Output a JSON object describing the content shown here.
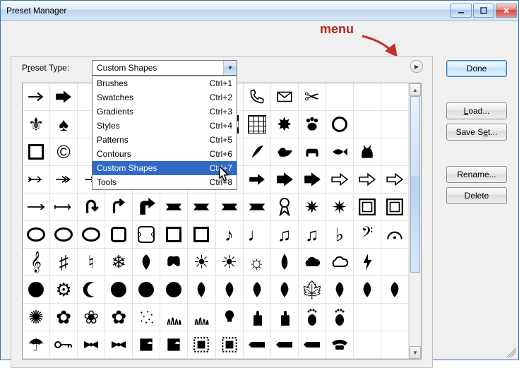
{
  "window": {
    "title": "Preset Manager"
  },
  "annotation": {
    "menu_label": "menu"
  },
  "preset": {
    "label_pre": "P",
    "label_u": "r",
    "label_post": "eset Type:",
    "value": "Custom Shapes"
  },
  "dropdown": {
    "items": [
      {
        "label": "Brushes",
        "shortcut": "Ctrl+1"
      },
      {
        "label": "Swatches",
        "shortcut": "Ctrl+2"
      },
      {
        "label": "Gradients",
        "shortcut": "Ctrl+3"
      },
      {
        "label": "Styles",
        "shortcut": "Ctrl+4"
      },
      {
        "label": "Patterns",
        "shortcut": "Ctrl+5"
      },
      {
        "label": "Contours",
        "shortcut": "Ctrl+6"
      },
      {
        "label": "Custom Shapes",
        "shortcut": "Ctrl+7",
        "selected": true
      },
      {
        "label": "Tools",
        "shortcut": "Ctrl+8"
      }
    ]
  },
  "buttons": {
    "done": "Done",
    "load": {
      "u": "L",
      "rest": "oad..."
    },
    "saveset": {
      "pre": "Save S",
      "u": "e",
      "post": "t..."
    },
    "rename": "Rename...",
    "delete": "Delete"
  },
  "shapes": {
    "rows": [
      [
        "arrow-thin-right",
        "arrow-bold-right",
        "",
        "",
        "",
        "",
        "grass",
        "lightbulb-outline",
        "phone-outline",
        "envelope",
        "scissors",
        "",
        "",
        ""
      ],
      [
        "fleur-de-lis",
        "spade",
        "",
        "",
        "",
        "",
        "hatched",
        "checkerboard",
        "grid",
        "starburst",
        "paw",
        "circle-outline",
        "",
        ""
      ],
      [
        "square-outline",
        "copyright",
        "",
        "",
        "",
        "",
        "snail",
        "rabbit",
        "feather",
        "bird",
        "dog",
        "fish",
        "cat",
        ""
      ],
      [
        "arrow-feather",
        "arrow-double",
        "arrow-small",
        "arrow-right",
        "arrow-right",
        "arrow-block",
        "arrow-block",
        "arrow-block",
        "arrow-block",
        "arrow-big",
        "arrow-big",
        "arrow-hollow",
        "arrow-hollow",
        "arrow-hollow"
      ],
      [
        "arrow-long",
        "arrow-line",
        "u-turn",
        "turn-right",
        "turn-right-bold",
        "banner",
        "banner",
        "banner",
        "banner",
        "ribbon",
        "seal",
        "seal",
        "frame",
        "frame"
      ],
      [
        "oval-outline",
        "oval-outline",
        "oval-outline",
        "rounded-square",
        "wavy-square",
        "square-outline",
        "square-outline",
        "eighth-note",
        "quarter-note",
        "beamed-notes",
        "beamed-notes",
        "flat",
        "bass-clef",
        "fermata"
      ],
      [
        "treble-clef",
        "sharp",
        "natural",
        "snowflake",
        "leaf",
        "butterfly",
        "sunburst",
        "sun",
        "sun-outline",
        "drop",
        "cloud",
        "cloud-outline",
        "lightning",
        "blank"
      ],
      [
        "blob",
        "gear",
        "crescent",
        "blob",
        "blob",
        "blob",
        "leaf",
        "leaf",
        "leaf",
        "leaf",
        "maple-leaf",
        "leaf",
        "leaf",
        "leaf"
      ],
      [
        "burst",
        "flower",
        "flower-outline",
        "flower",
        "dots",
        "grass",
        "grass",
        "lightbulb",
        "hand",
        "hand",
        "foot",
        "foot",
        "blank",
        "blank"
      ],
      [
        "umbrella",
        "key",
        "bow",
        "bow",
        "puzzle",
        "puzzle",
        "stamp",
        "stamp",
        "pencil",
        "pencil",
        "pencil",
        "phone",
        "blank",
        "blank"
      ]
    ]
  }
}
